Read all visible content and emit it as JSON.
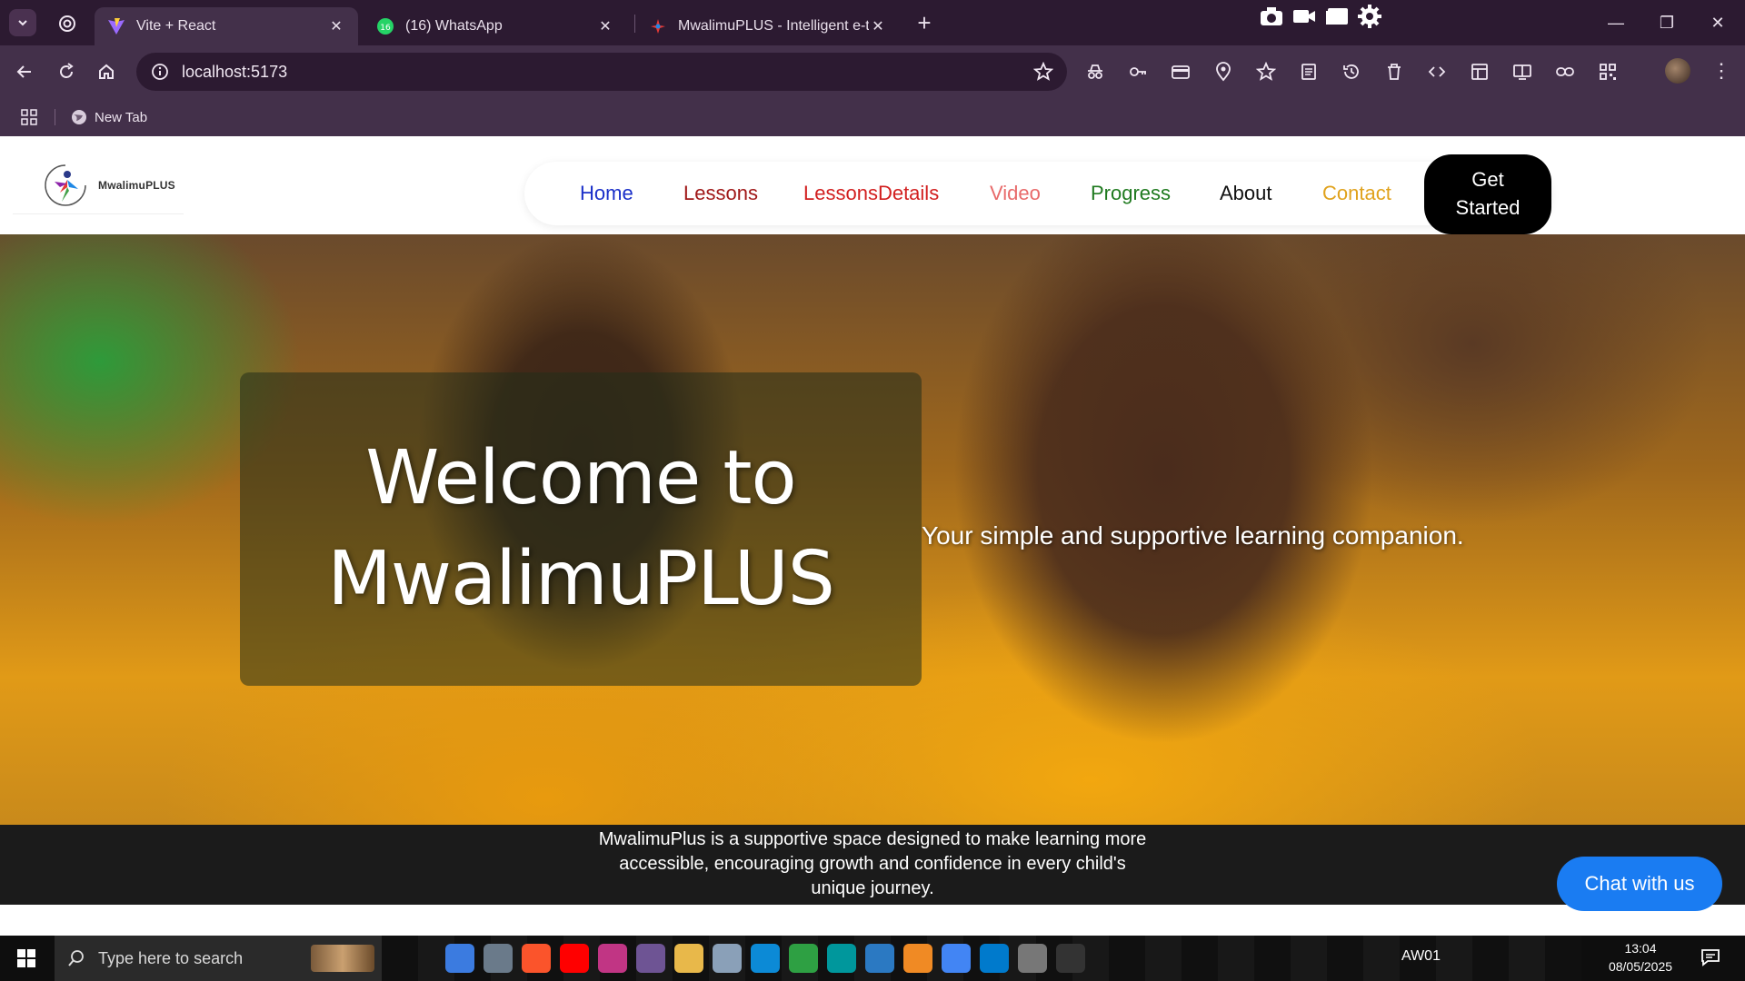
{
  "browser": {
    "tabs": [
      {
        "title": "Vite + React",
        "active": true
      },
      {
        "title": "(16) WhatsApp",
        "active": false,
        "badge": "16"
      },
      {
        "title": "MwalimuPLUS - Intelligent e-tu",
        "active": false
      }
    ],
    "url": "localhost:5173",
    "bookmark": "New Tab"
  },
  "site": {
    "logo_text": "MwalimuPLUS",
    "nav": [
      {
        "label": "Home",
        "color": "#1a2fc9"
      },
      {
        "label": "Lessons",
        "color": "#a01818"
      },
      {
        "label": "LessonsDetails",
        "color": "#d21f1f"
      },
      {
        "label": "Video",
        "color": "#e86a6a"
      },
      {
        "label": "Progress",
        "color": "#1f7a1f"
      },
      {
        "label": "About",
        "color": "#111111"
      },
      {
        "label": "Contact",
        "color": "#e0a21c"
      }
    ],
    "cta_line1": "Get",
    "cta_line2": "Started",
    "hero_line1": "Welcome to",
    "hero_line2": "MwalimuPLUS",
    "hero_subtitle": "Your simple and supportive learning companion.",
    "about": "MwalimuPlus is a supportive space designed to make learning more accessible, encouraging growth and confidence in every child's unique journey.",
    "chat": "Chat with us"
  },
  "taskbar": {
    "search_placeholder": "Type here to search",
    "tray_label": "AW01",
    "time": "13:04",
    "date": "08/05/2025"
  }
}
